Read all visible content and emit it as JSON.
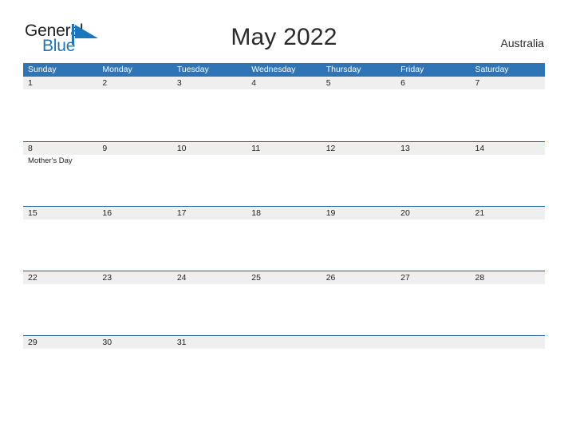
{
  "brand": {
    "name_dark": "General",
    "name_blue": "Blue",
    "flag_icon": "blue-flag-icon",
    "colors": {
      "dark": "#231f20",
      "blue": "#1b76bc"
    }
  },
  "header": {
    "title": "May 2022",
    "locale": "Australia"
  },
  "theme": {
    "header_blue": "#2f74b5",
    "row_border": "#1f5f9e",
    "date_band": "#efefef",
    "page_background": "#ffffff"
  },
  "calendar": {
    "month": "May",
    "year": "2022",
    "country": "Australia",
    "day_headers": [
      "Sunday",
      "Monday",
      "Tuesday",
      "Wednesday",
      "Thursday",
      "Friday",
      "Saturday"
    ],
    "weeks": [
      [
        {
          "date": "1",
          "events": []
        },
        {
          "date": "2",
          "events": []
        },
        {
          "date": "3",
          "events": []
        },
        {
          "date": "4",
          "events": []
        },
        {
          "date": "5",
          "events": []
        },
        {
          "date": "6",
          "events": []
        },
        {
          "date": "7",
          "events": []
        }
      ],
      [
        {
          "date": "8",
          "events": [
            "Mother's Day"
          ]
        },
        {
          "date": "9",
          "events": []
        },
        {
          "date": "10",
          "events": []
        },
        {
          "date": "11",
          "events": []
        },
        {
          "date": "12",
          "events": []
        },
        {
          "date": "13",
          "events": []
        },
        {
          "date": "14",
          "events": []
        }
      ],
      [
        {
          "date": "15",
          "events": []
        },
        {
          "date": "16",
          "events": []
        },
        {
          "date": "17",
          "events": []
        },
        {
          "date": "18",
          "events": []
        },
        {
          "date": "19",
          "events": []
        },
        {
          "date": "20",
          "events": []
        },
        {
          "date": "21",
          "events": []
        }
      ],
      [
        {
          "date": "22",
          "events": []
        },
        {
          "date": "23",
          "events": []
        },
        {
          "date": "24",
          "events": []
        },
        {
          "date": "25",
          "events": []
        },
        {
          "date": "26",
          "events": []
        },
        {
          "date": "27",
          "events": []
        },
        {
          "date": "28",
          "events": []
        }
      ],
      [
        {
          "date": "29",
          "events": []
        },
        {
          "date": "30",
          "events": []
        },
        {
          "date": "31",
          "events": []
        },
        {
          "date": "",
          "events": []
        },
        {
          "date": "",
          "events": []
        },
        {
          "date": "",
          "events": []
        },
        {
          "date": "",
          "events": []
        }
      ]
    ]
  }
}
